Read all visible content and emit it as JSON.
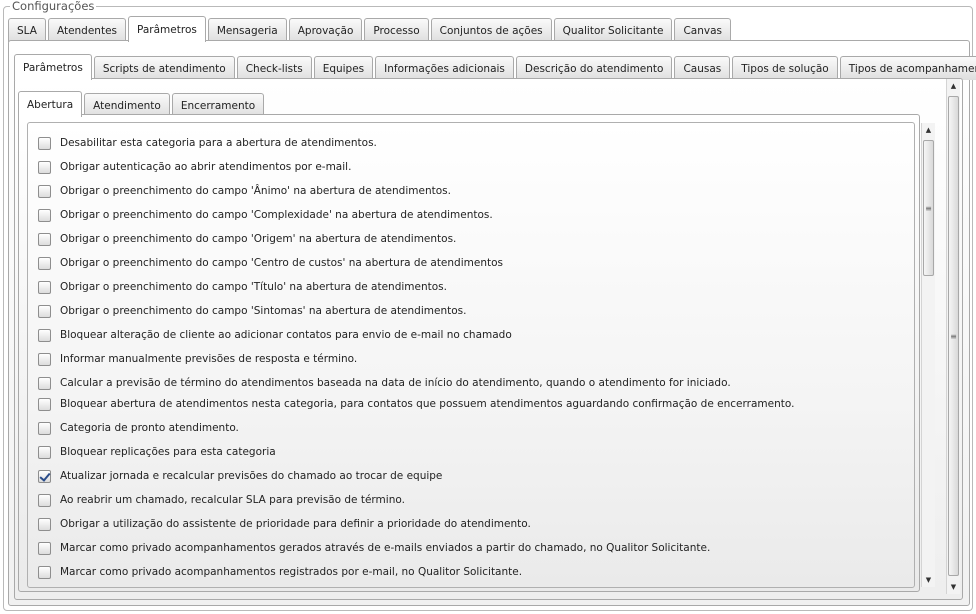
{
  "legend": "Configurações",
  "tabs_top": [
    {
      "label": "SLA"
    },
    {
      "label": "Atendentes"
    },
    {
      "label": "Parâmetros",
      "active": true
    },
    {
      "label": "Mensageria"
    },
    {
      "label": "Aprovação"
    },
    {
      "label": "Processo"
    },
    {
      "label": "Conjuntos de ações"
    },
    {
      "label": "Qualitor Solicitante"
    },
    {
      "label": "Canvas"
    }
  ],
  "tabs_second": [
    {
      "label": "Parâmetros",
      "active": true
    },
    {
      "label": "Scripts de atendimento"
    },
    {
      "label": "Check-lists"
    },
    {
      "label": "Equipes"
    },
    {
      "label": "Informações adicionais"
    },
    {
      "label": "Descrição do atendimento"
    },
    {
      "label": "Causas"
    },
    {
      "label": "Tipos de solução"
    },
    {
      "label": "Tipos de acompanhamento"
    }
  ],
  "tabs_third": [
    {
      "label": "Abertura",
      "active": true
    },
    {
      "label": "Atendimento"
    },
    {
      "label": "Encerramento"
    }
  ],
  "options": [
    {
      "label": "Desabilitar esta categoria para a abertura de atendimentos.",
      "checked": false
    },
    {
      "label": "Obrigar autenticação ao abrir atendimentos por e-mail.",
      "checked": false
    },
    {
      "label": "Obrigar o preenchimento do campo 'Ânimo' na abertura de atendimentos.",
      "checked": false
    },
    {
      "label": "Obrigar o preenchimento do campo 'Complexidade' na abertura de atendimentos.",
      "checked": false
    },
    {
      "label": "Obrigar o preenchimento do campo 'Origem' na abertura de atendimentos.",
      "checked": false
    },
    {
      "label": "Obrigar o preenchimento do campo 'Centro de custos' na abertura de atendimentos",
      "checked": false
    },
    {
      "label": "Obrigar o preenchimento do campo 'Título' na abertura de atendimentos.",
      "checked": false
    },
    {
      "label": "Obrigar o preenchimento do campo 'Sintomas' na abertura de atendimentos.",
      "checked": false
    },
    {
      "label": "Bloquear alteração de cliente ao adicionar contatos para envio de e-mail no chamado",
      "checked": false
    },
    {
      "label": "Informar manualmente previsões de resposta e término.",
      "checked": false
    },
    {
      "label": "Calcular a previsão de término do atendimentos baseada na data de início do atendimento, quando o atendimento for iniciado.",
      "checked": false
    },
    {
      "label": "Bloquear abertura de atendimentos nesta categoria, para contatos que possuem atendimentos aguardando confirmação de encerramento.",
      "checked": false
    },
    {
      "label": "Categoria de pronto atendimento.",
      "checked": false
    },
    {
      "label": "Bloquear replicações para esta categoria",
      "checked": false
    },
    {
      "label": "Atualizar jornada e recalcular previsões do chamado ao trocar de equipe",
      "checked": true
    },
    {
      "label": "Ao reabrir um chamado, recalcular SLA para previsão de término.",
      "checked": false
    },
    {
      "label": "Obrigar a utilização do assistente de prioridade para definir a prioridade do atendimento.",
      "checked": false
    },
    {
      "label": "Marcar como privado acompanhamentos gerados através de e-mails enviados a partir do chamado, no Qualitor Solicitante.",
      "checked": false
    },
    {
      "label": "Marcar como privado acompanhamentos registrados por e-mail, no Qualitor Solicitante.",
      "checked": false
    }
  ]
}
